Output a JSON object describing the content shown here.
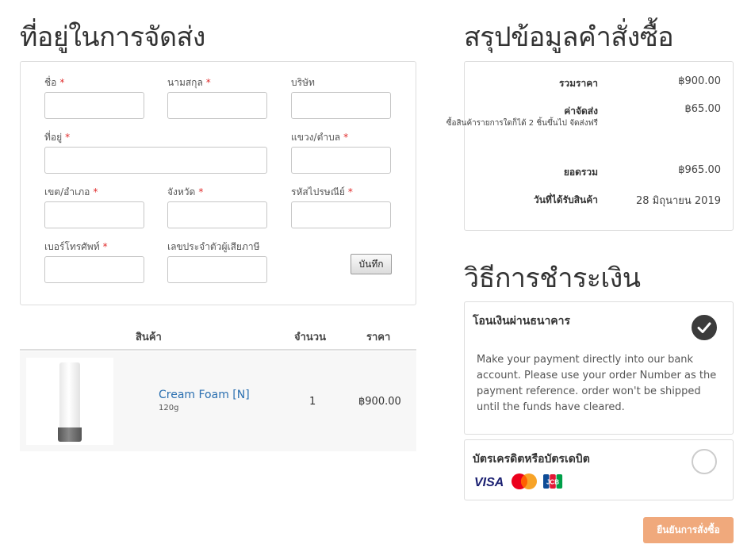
{
  "shipping": {
    "heading": "ที่อยู่ในการจัดส่ง",
    "fields": {
      "first_name": {
        "label": "ชื่อ",
        "required": "*",
        "value": ""
      },
      "last_name": {
        "label": "นามสกุล",
        "required": "*",
        "value": ""
      },
      "company": {
        "label": "บริษัท",
        "value": ""
      },
      "address": {
        "label": "ที่อยู่",
        "required": "*",
        "value": ""
      },
      "subdistrict": {
        "label": "แขวง/ตำบล",
        "required": "*",
        "value": ""
      },
      "district": {
        "label": "เขต/อำเภอ",
        "required": "*",
        "value": ""
      },
      "province": {
        "label": "จังหวัด",
        "required": "*",
        "value": ""
      },
      "postcode": {
        "label": "รหัสไปรษณีย์",
        "required": "*",
        "value": ""
      },
      "phone": {
        "label": "เบอร์โทรศัพท์",
        "required": "*",
        "value": ""
      },
      "tax_id": {
        "label": "เลขประจำตัวผู้เสียภาษี",
        "value": ""
      }
    },
    "save_label": "บันทึก"
  },
  "cart": {
    "headers": {
      "product": "สินค้า",
      "qty": "จำนวน",
      "price": "ราคา"
    },
    "items": [
      {
        "name": "Cream Foam [N]",
        "size": "120g",
        "qty": "1",
        "price": "฿900.00",
        "image_icon": "cream-tube-image"
      }
    ]
  },
  "summary": {
    "heading": "สรุปข้อมูลคำสั่งซื้อ",
    "subtotal_label": "รวมราคา",
    "subtotal_value": "฿900.00",
    "shipping_label": "ค่าจัดส่ง",
    "shipping_note": "ซื้อสินค้ารายการใดก็ได้ 2 ชิ้นขึ้นไป จัดส่งฟรี",
    "shipping_value": "฿65.00",
    "total_label": "ยอดรวม",
    "total_value": "฿965.00",
    "delivery_label": "วันที่ได้รับสินค้า",
    "delivery_value": "28 มิถุนายน 2019"
  },
  "payment": {
    "heading": "วิธีการชำระเงิน",
    "methods": [
      {
        "title": "โอนเงินผ่านธนาคาร",
        "selected": true,
        "description": "Make your payment directly into our bank account. Please use your order Number as the payment reference. order won't be shipped until the funds have cleared."
      },
      {
        "title": "บัตรเครดิตหรือบัตรเดบิต",
        "selected": false,
        "cards": [
          "visa-icon",
          "mastercard-icon",
          "jcb-icon"
        ],
        "visa_text": "VISA",
        "jcb_text": "JCB"
      }
    ],
    "confirm_label": "ยืนยันการสั่งซื้อ"
  },
  "colors": {
    "link": "#2a6fb0",
    "required": "#e02b2b",
    "confirm_button": "#f0a97c",
    "radio_selected": "#3b3b3b"
  }
}
